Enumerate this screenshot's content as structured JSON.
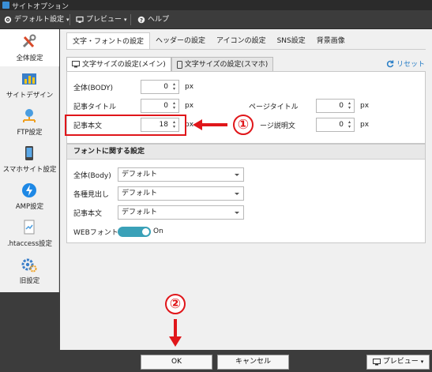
{
  "window": {
    "title": "サイトオプション"
  },
  "toolbar": {
    "default_settings_label": "デフォルト設定",
    "preview_label": "プレビュー",
    "help_label": "ヘルプ"
  },
  "sidebar": {
    "items": [
      {
        "label": "全体設定",
        "icon": "tools-icon"
      },
      {
        "label": "サイトデザイン",
        "icon": "bar-chart-icon"
      },
      {
        "label": "FTP設定",
        "icon": "network-icon"
      },
      {
        "label": "スマホサイト設定",
        "icon": "smartphone-icon"
      },
      {
        "label": "AMP設定",
        "icon": "amp-icon"
      },
      {
        "label": ".htaccess設定",
        "icon": "document-icon"
      },
      {
        "label": "旧設定",
        "icon": "gear-icon"
      }
    ]
  },
  "tabs": [
    "文字・フォントの設定",
    "ヘッダーの設定",
    "アイコンの設定",
    "SNS設定",
    "背景画像"
  ],
  "sub_tabs": [
    "文字サイズの設定(メイン)",
    "文字サイズの設定(スマホ)"
  ],
  "reset_label": "リセット",
  "font_size": {
    "body": {
      "label": "全体(BODY)",
      "value": "0",
      "unit": "px"
    },
    "article_title": {
      "label": "記事タイトル",
      "value": "0",
      "unit": "px"
    },
    "article_body": {
      "label": "記事本文",
      "value": "18",
      "unit": "px"
    },
    "page_title": {
      "label": "ページタイトル",
      "value": "0",
      "unit": "px"
    },
    "page_desc": {
      "label": "ージ説明文",
      "value": "0",
      "unit": "px"
    }
  },
  "font_section": {
    "heading": "フォントに関する設定",
    "rows": [
      {
        "label": "全体(Body)",
        "value": "デフォルト"
      },
      {
        "label": "各種見出し",
        "value": "デフォルト"
      },
      {
        "label": "記事本文",
        "value": "デフォルト"
      }
    ],
    "web_font": {
      "label": "WEBフォント",
      "state": "On"
    }
  },
  "annotations": {
    "step1": "①",
    "step2": "②",
    "accent": "#e0161a"
  },
  "footer": {
    "ok_label": "OK",
    "cancel_label": "キャンセル",
    "preview_label": "プレビュー"
  }
}
